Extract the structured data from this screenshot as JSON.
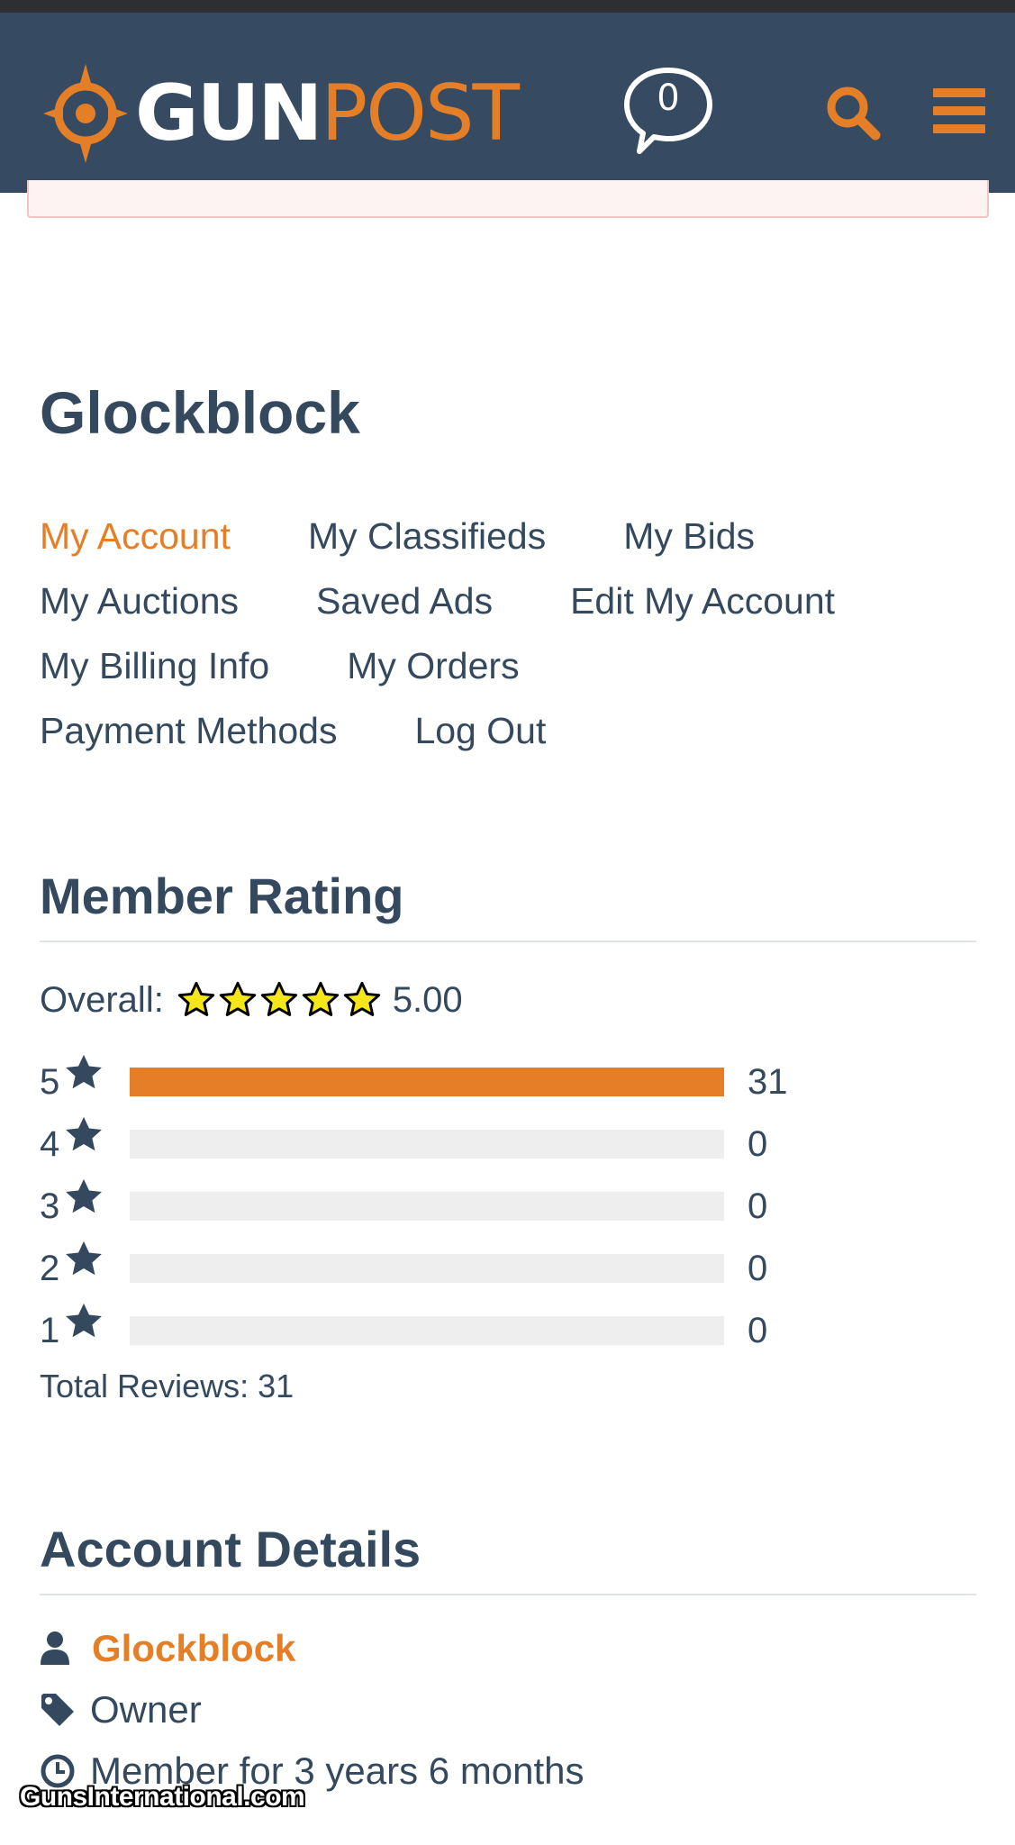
{
  "brand": {
    "name_part1": "GUN",
    "name_part2": "POST",
    "accent_color": "#e57f27",
    "header_color": "#364a61"
  },
  "header": {
    "message_count": "0",
    "search_icon": "search-icon",
    "menu_icon": "hamburger-menu-icon"
  },
  "profile": {
    "username": "Glockblock"
  },
  "nav": {
    "rows": [
      [
        "My Account",
        "My Classifieds",
        "My Bids"
      ],
      [
        "My Auctions",
        "Saved Ads",
        "Edit My Account"
      ],
      [
        "My Billing Info",
        "My Orders"
      ],
      [
        "Payment Methods",
        "Log Out"
      ]
    ],
    "active": "My Account"
  },
  "member_rating": {
    "title": "Member Rating",
    "overall_label": "Overall:",
    "overall_value": "5.00",
    "overall_stars": 5,
    "rows": [
      {
        "stars": "5",
        "count": "31",
        "fraction": 1.0
      },
      {
        "stars": "4",
        "count": "0",
        "fraction": 0
      },
      {
        "stars": "3",
        "count": "0",
        "fraction": 0
      },
      {
        "stars": "2",
        "count": "0",
        "fraction": 0
      },
      {
        "stars": "1",
        "count": "0",
        "fraction": 0
      }
    ],
    "total_label": "Total Reviews: 31"
  },
  "account_details": {
    "title": "Account Details",
    "username": "Glockblock",
    "role": "Owner",
    "member_for": "Member for 3 years 6 months"
  },
  "watermark": "GunsInternational.com"
}
